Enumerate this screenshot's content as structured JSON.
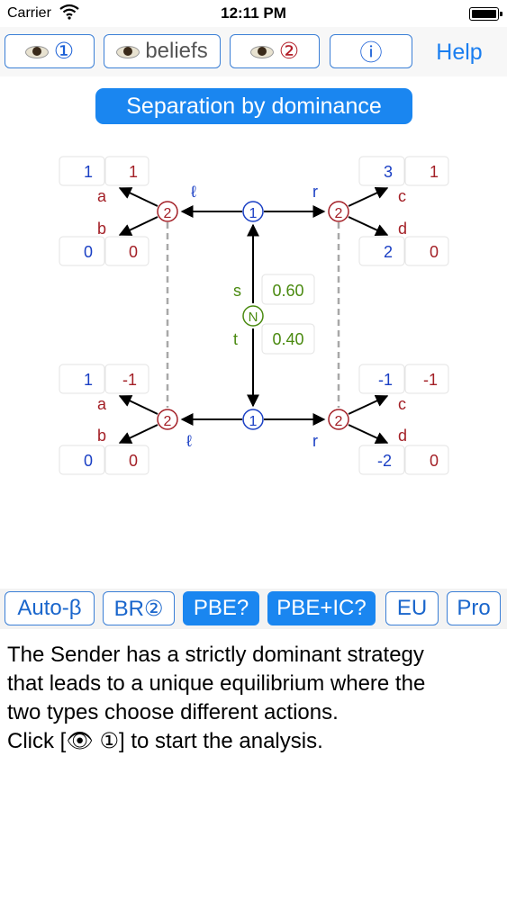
{
  "status_bar": {
    "carrier": "Carrier",
    "time": "12:11 PM"
  },
  "toolbar": {
    "view_player1": {
      "icon": "eye-icon",
      "symbol": "①"
    },
    "view_beliefs": {
      "icon": "eye-icon",
      "label": "beliefs"
    },
    "view_player2": {
      "icon": "eye-icon",
      "symbol": "②"
    },
    "info_symbol": "ⓘ",
    "help_label": "Help"
  },
  "title": "Separation by dominance",
  "tree": {
    "player1": "1",
    "player2": "2",
    "nature": "N",
    "action_left": "ℓ",
    "action_right": "r",
    "nature_move_top": "s",
    "nature_move_bottom": "t",
    "prob_top": "0.60",
    "prob_bottom": "0.40",
    "resp_a": "a",
    "resp_b": "b",
    "resp_c": "c",
    "resp_d": "d",
    "payoffs": {
      "top_left_a": [
        "1",
        "1"
      ],
      "top_left_b": [
        "0",
        "0"
      ],
      "top_right_c": [
        "3",
        "1"
      ],
      "top_right_d": [
        "2",
        "0"
      ],
      "bottom_left_a": [
        "1",
        "-1"
      ],
      "bottom_left_b": [
        "0",
        "0"
      ],
      "bottom_right_c": [
        "-1",
        "-1"
      ],
      "bottom_right_d": [
        "-2",
        "0"
      ]
    },
    "colors": {
      "player1": "#1a3fc4",
      "player2": "#a31f26",
      "nature": "#4a8a10",
      "line": "#000000",
      "info_set": "#a8a8a8"
    }
  },
  "bottom_bar": {
    "auto_beta": "Auto-β",
    "br2": "BR②",
    "pbe": "PBE?",
    "pbe_ic": "PBE+IC?",
    "eu": "EU",
    "pro": "Pro"
  },
  "description": {
    "lines": [
      "The Sender has a strictly dominant strategy",
      "that leads to a unique equilibrium where the",
      "two types choose different actions.",
      "Click [👁 ①] to start the analysis."
    ]
  }
}
